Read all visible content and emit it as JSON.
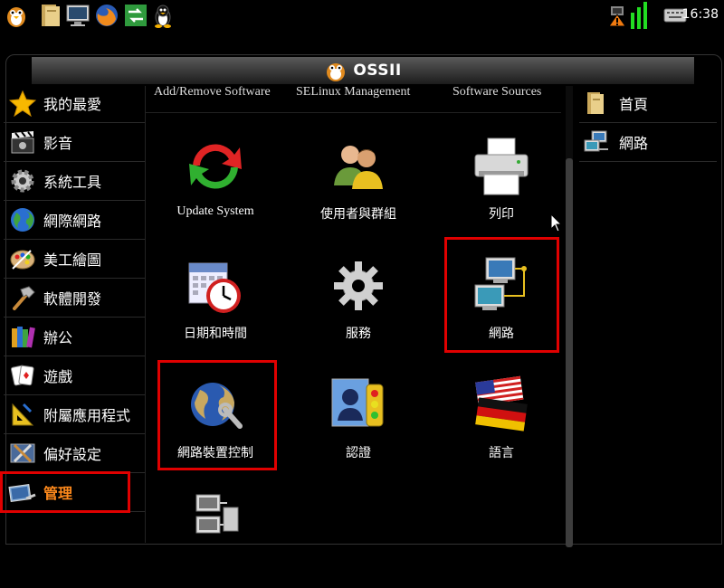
{
  "taskbar": {
    "clock": "16:38",
    "left_icons": [
      "ossii-penguin-icon",
      "file-manager-icon",
      "monitor-icon",
      "firefox-icon",
      "switch-window-icon",
      "tux-icon"
    ],
    "right_icons": [
      "network-warning-icon",
      "signal-bars-icon",
      "keyboard-icon"
    ]
  },
  "window": {
    "title": "OSSII"
  },
  "sidebar": {
    "items": [
      {
        "label": "我的最愛",
        "icon": "star-icon"
      },
      {
        "label": "影音",
        "icon": "clapperboard-icon"
      },
      {
        "label": "系統工具",
        "icon": "gear-icon"
      },
      {
        "label": "網際網路",
        "icon": "globe-icon"
      },
      {
        "label": "美工繪圖",
        "icon": "palette-icon"
      },
      {
        "label": "軟體開發",
        "icon": "hammer-icon"
      },
      {
        "label": "辦公",
        "icon": "books-icon"
      },
      {
        "label": "遊戲",
        "icon": "cards-icon"
      },
      {
        "label": "附屬應用程式",
        "icon": "ruler-icon"
      },
      {
        "label": "偏好設定",
        "icon": "preferences-icon"
      },
      {
        "label": "管理",
        "icon": "admin-icon"
      }
    ],
    "active_index": 10
  },
  "top_links": [
    "Add/Remove Software",
    "SELinux Management",
    "Software Sources"
  ],
  "apps": [
    {
      "label": "Update System",
      "icon": "update-arrows-icon"
    },
    {
      "label": "使用者與群組",
      "icon": "users-icon"
    },
    {
      "label": "列印",
      "icon": "printer-icon"
    },
    {
      "label": "日期和時間",
      "icon": "calendar-clock-icon"
    },
    {
      "label": "服務",
      "icon": "gear-icon"
    },
    {
      "label": "網路",
      "icon": "network-computers-icon"
    },
    {
      "label": "網路裝置控制",
      "icon": "globe-wrench-icon"
    },
    {
      "label": "認證",
      "icon": "authentication-icon"
    },
    {
      "label": "語言",
      "icon": "flags-icon"
    },
    {
      "label": "",
      "icon": "server-icon"
    }
  ],
  "right_panel": {
    "items": [
      {
        "label": "首頁",
        "icon": "home-folder-icon"
      },
      {
        "label": "網路",
        "icon": "network-icon"
      }
    ]
  },
  "colors": {
    "active_text": "#ff8a1c",
    "highlight_border": "#e00000",
    "background": "#000000",
    "titlebar": "#3a3a3a"
  }
}
